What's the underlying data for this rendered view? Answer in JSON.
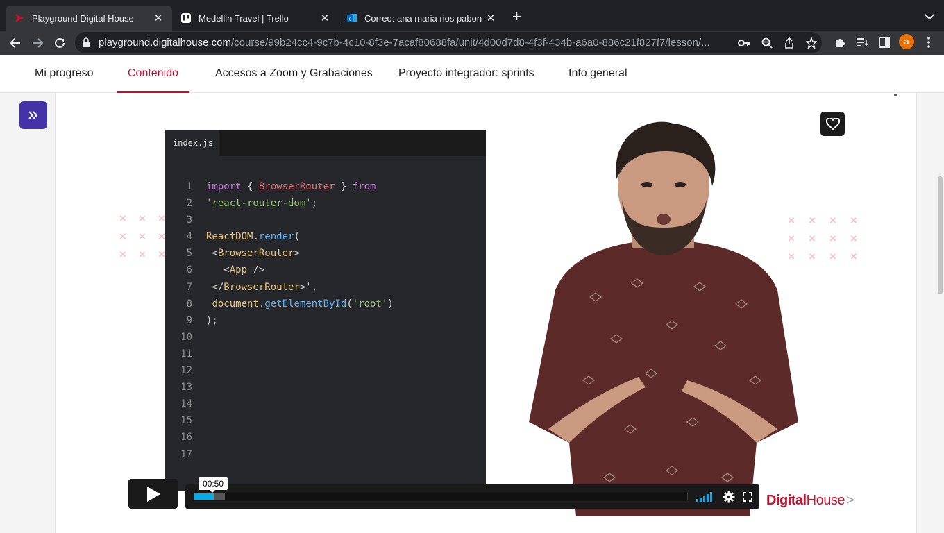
{
  "browser": {
    "tabs": [
      {
        "title": "Playground Digital House",
        "active": true
      },
      {
        "title": "Medellin Travel | Trello",
        "active": false
      },
      {
        "title": "Correo: ana maria rios pabon -",
        "active": false
      }
    ],
    "url_host": "playground.digitalhouse.com",
    "url_path": "/course/99b24cc4-9c7b-4c10-8f3e-7acaf80688fa/unit/4d00d7d8-4f3f-434b-a6a0-886c21f827f7/lesson/...",
    "profile_initial": "a"
  },
  "course_nav": {
    "tabs": [
      {
        "label": "Mi progreso",
        "active": false
      },
      {
        "label": "Contenido",
        "active": true
      },
      {
        "label": "Accesos a Zoom y Grabaciones",
        "active": false
      },
      {
        "label": "Proyecto integrador: sprints",
        "active": false
      },
      {
        "label": "Info general",
        "active": false
      }
    ]
  },
  "video": {
    "editor_filename": "index.js",
    "line_numbers": [
      "1",
      "2",
      "3",
      "4",
      "5",
      "6",
      "7",
      "8",
      "9",
      "10",
      "11",
      "12",
      "13",
      "14",
      "15",
      "16",
      "17"
    ],
    "current_time": "00:50",
    "progress": 0.04,
    "logo_part1": "Digital",
    "logo_part2": "House",
    "logo_suffix": ">"
  },
  "colors": {
    "brand_red": "#c8102e",
    "sidebar_toggle": "#4333a6",
    "progress": "#00adef"
  }
}
